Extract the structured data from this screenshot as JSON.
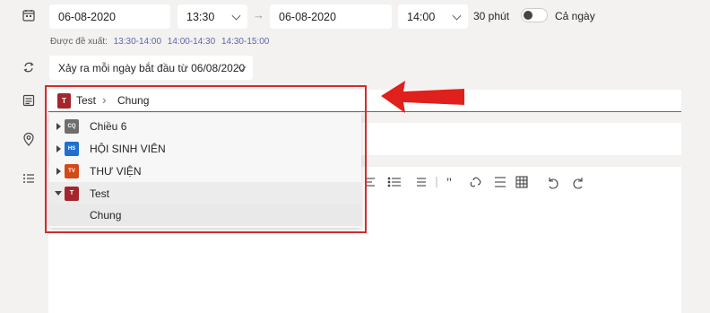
{
  "meeting": {
    "start_date": "06-08-2020",
    "start_time": "13:30",
    "end_date": "06-08-2020",
    "end_time": "14:00",
    "duration": "30 phút",
    "all_day_label": "Cả ngày",
    "arrow": "→"
  },
  "suggestions": {
    "label": "Được đề xuất:",
    "slots": [
      "13:30-14:00",
      "14:00-14:30",
      "14:30-15:00"
    ]
  },
  "recurrence": {
    "value": "Xảy ra mỗi ngày bắt đầu từ 06/08/2020"
  },
  "channel": {
    "team_initial": "T",
    "team": "Test",
    "separator": "›",
    "channel": "Chung"
  },
  "dropdown": {
    "teams": [
      {
        "name": "Chiều 6",
        "avatar": "CQ",
        "color": "#6e6e6e",
        "expanded": false
      },
      {
        "name": "HỘI SINH VIÊN",
        "avatar": "HS",
        "color": "#1f6fd1",
        "expanded": false
      },
      {
        "name": "THƯ VIỆN",
        "avatar": "TV",
        "color": "#d34a1a",
        "expanded": false
      },
      {
        "name": "Test",
        "avatar": "T",
        "color": "#a4262c",
        "expanded": true
      }
    ],
    "channels": [
      "Chung"
    ]
  },
  "colors": {
    "accent": "#6264a7",
    "highlight": "#d42b2b",
    "arrow": "#e0201c"
  },
  "icons": [
    "calendar-icon",
    "repeat-icon",
    "channel-icon",
    "location-icon",
    "details-icon"
  ]
}
